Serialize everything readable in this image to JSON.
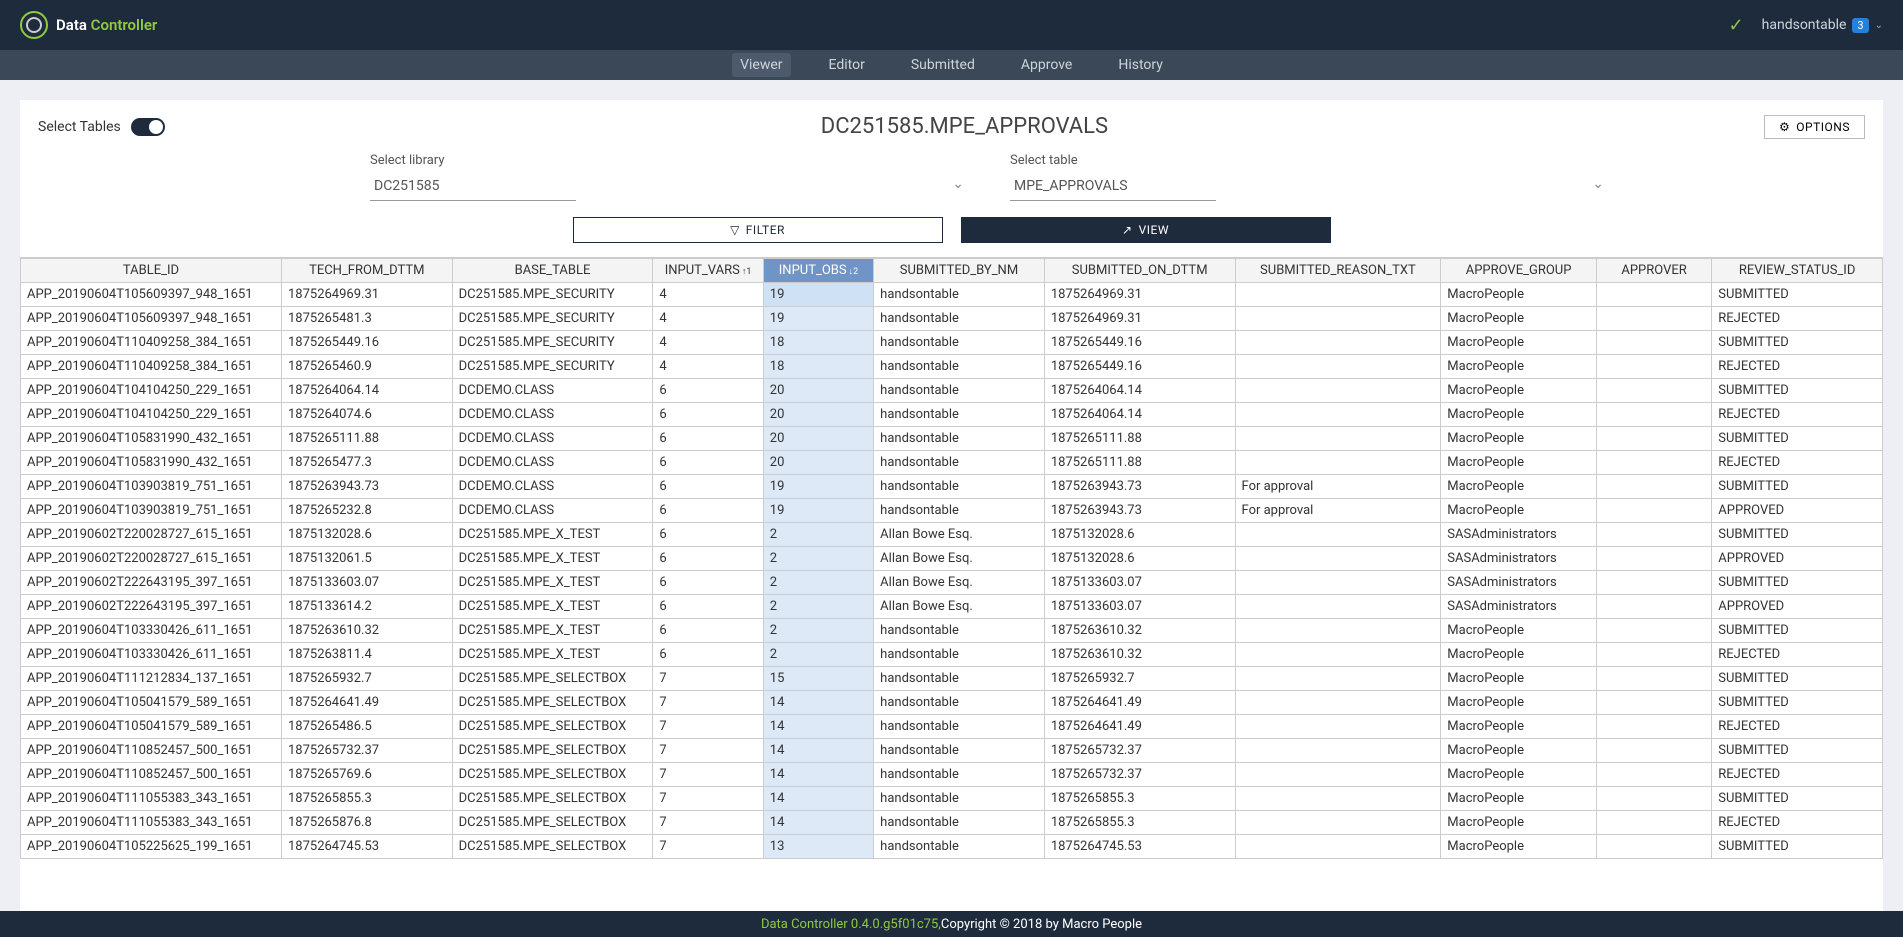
{
  "header": {
    "logo_white": "Data ",
    "logo_green": "Controller",
    "user": "handsontable",
    "badge": "3"
  },
  "nav": {
    "items": [
      "Viewer",
      "Editor",
      "Submitted",
      "Approve",
      "History"
    ],
    "active": 0
  },
  "page": {
    "select_tables_label": "Select Tables",
    "title": "DC251585.MPE_APPROVALS",
    "options_label": "OPTIONS",
    "library_label": "Select library",
    "library_value": "DC251585",
    "table_label": "Select table",
    "table_value": "MPE_APPROVALS",
    "filter_label": "FILTER",
    "view_label": "VIEW"
  },
  "columns": [
    "TABLE_ID",
    "TECH_FROM_DTTM",
    "BASE_TABLE",
    "INPUT_VARS",
    "INPUT_OBS",
    "SUBMITTED_BY_NM",
    "SUBMITTED_ON_DTTM",
    "SUBMITTED_REASON_TXT",
    "APPROVE_GROUP",
    "APPROVER",
    "REVIEW_STATUS_ID"
  ],
  "sort": {
    "col3_ind": "↑1",
    "col4_ind": "↓2"
  },
  "rows": [
    [
      "APP_20190604T105609397_948_1651",
      "1875264969.31",
      "DC251585.MPE_SECURITY",
      "4",
      "19",
      "handsontable",
      "1875264969.31",
      "",
      "MacroPeople",
      "",
      "SUBMITTED"
    ],
    [
      "APP_20190604T105609397_948_1651",
      "1875265481.3",
      "DC251585.MPE_SECURITY",
      "4",
      "19",
      "handsontable",
      "1875264969.31",
      "",
      "MacroPeople",
      "",
      "REJECTED"
    ],
    [
      "APP_20190604T110409258_384_1651",
      "1875265449.16",
      "DC251585.MPE_SECURITY",
      "4",
      "18",
      "handsontable",
      "1875265449.16",
      "",
      "MacroPeople",
      "",
      "SUBMITTED"
    ],
    [
      "APP_20190604T110409258_384_1651",
      "1875265460.9",
      "DC251585.MPE_SECURITY",
      "4",
      "18",
      "handsontable",
      "1875265449.16",
      "",
      "MacroPeople",
      "",
      "REJECTED"
    ],
    [
      "APP_20190604T104104250_229_1651",
      "1875264064.14",
      "DCDEMO.CLASS",
      "6",
      "20",
      "handsontable",
      "1875264064.14",
      "",
      "MacroPeople",
      "",
      "SUBMITTED"
    ],
    [
      "APP_20190604T104104250_229_1651",
      "1875264074.6",
      "DCDEMO.CLASS",
      "6",
      "20",
      "handsontable",
      "1875264064.14",
      "",
      "MacroPeople",
      "",
      "REJECTED"
    ],
    [
      "APP_20190604T105831990_432_1651",
      "1875265111.88",
      "DCDEMO.CLASS",
      "6",
      "20",
      "handsontable",
      "1875265111.88",
      "",
      "MacroPeople",
      "",
      "SUBMITTED"
    ],
    [
      "APP_20190604T105831990_432_1651",
      "1875265477.3",
      "DCDEMO.CLASS",
      "6",
      "20",
      "handsontable",
      "1875265111.88",
      "",
      "MacroPeople",
      "",
      "REJECTED"
    ],
    [
      "APP_20190604T103903819_751_1651",
      "1875263943.73",
      "DCDEMO.CLASS",
      "6",
      "19",
      "handsontable",
      "1875263943.73",
      "For approval",
      "MacroPeople",
      "",
      "SUBMITTED"
    ],
    [
      "APP_20190604T103903819_751_1651",
      "1875265232.8",
      "DCDEMO.CLASS",
      "6",
      "19",
      "handsontable",
      "1875263943.73",
      "For approval",
      "MacroPeople",
      "",
      "APPROVED"
    ],
    [
      "APP_20190602T220028727_615_1651",
      "1875132028.6",
      "DC251585.MPE_X_TEST",
      "6",
      "2",
      "Allan Bowe Esq.",
      "1875132028.6",
      "",
      "SASAdministrators",
      "",
      "SUBMITTED"
    ],
    [
      "APP_20190602T220028727_615_1651",
      "1875132061.5",
      "DC251585.MPE_X_TEST",
      "6",
      "2",
      "Allan Bowe Esq.",
      "1875132028.6",
      "",
      "SASAdministrators",
      "",
      "APPROVED"
    ],
    [
      "APP_20190602T222643195_397_1651",
      "1875133603.07",
      "DC251585.MPE_X_TEST",
      "6",
      "2",
      "Allan Bowe Esq.",
      "1875133603.07",
      "",
      "SASAdministrators",
      "",
      "SUBMITTED"
    ],
    [
      "APP_20190602T222643195_397_1651",
      "1875133614.2",
      "DC251585.MPE_X_TEST",
      "6",
      "2",
      "Allan Bowe Esq.",
      "1875133603.07",
      "",
      "SASAdministrators",
      "",
      "APPROVED"
    ],
    [
      "APP_20190604T103330426_611_1651",
      "1875263610.32",
      "DC251585.MPE_X_TEST",
      "6",
      "2",
      "handsontable",
      "1875263610.32",
      "",
      "MacroPeople",
      "",
      "SUBMITTED"
    ],
    [
      "APP_20190604T103330426_611_1651",
      "1875263811.4",
      "DC251585.MPE_X_TEST",
      "6",
      "2",
      "handsontable",
      "1875263610.32",
      "",
      "MacroPeople",
      "",
      "REJECTED"
    ],
    [
      "APP_20190604T111212834_137_1651",
      "1875265932.7",
      "DC251585.MPE_SELECTBOX",
      "7",
      "15",
      "handsontable",
      "1875265932.7",
      "",
      "MacroPeople",
      "",
      "SUBMITTED"
    ],
    [
      "APP_20190604T105041579_589_1651",
      "1875264641.49",
      "DC251585.MPE_SELECTBOX",
      "7",
      "14",
      "handsontable",
      "1875264641.49",
      "",
      "MacroPeople",
      "",
      "SUBMITTED"
    ],
    [
      "APP_20190604T105041579_589_1651",
      "1875265486.5",
      "DC251585.MPE_SELECTBOX",
      "7",
      "14",
      "handsontable",
      "1875264641.49",
      "",
      "MacroPeople",
      "",
      "REJECTED"
    ],
    [
      "APP_20190604T110852457_500_1651",
      "1875265732.37",
      "DC251585.MPE_SELECTBOX",
      "7",
      "14",
      "handsontable",
      "1875265732.37",
      "",
      "MacroPeople",
      "",
      "SUBMITTED"
    ],
    [
      "APP_20190604T110852457_500_1651",
      "1875265769.6",
      "DC251585.MPE_SELECTBOX",
      "7",
      "14",
      "handsontable",
      "1875265732.37",
      "",
      "MacroPeople",
      "",
      "REJECTED"
    ],
    [
      "APP_20190604T111055383_343_1651",
      "1875265855.3",
      "DC251585.MPE_SELECTBOX",
      "7",
      "14",
      "handsontable",
      "1875265855.3",
      "",
      "MacroPeople",
      "",
      "SUBMITTED"
    ],
    [
      "APP_20190604T111055383_343_1651",
      "1875265876.8",
      "DC251585.MPE_SELECTBOX",
      "7",
      "14",
      "handsontable",
      "1875265855.3",
      "",
      "MacroPeople",
      "",
      "REJECTED"
    ],
    [
      "APP_20190604T105225625_199_1651",
      "1875264745.53",
      "DC251585.MPE_SELECTBOX",
      "7",
      "13",
      "handsontable",
      "1875264745.53",
      "",
      "MacroPeople",
      "",
      "SUBMITTED"
    ]
  ],
  "footer": {
    "green": "Data Controller 0.4.0.g5f01c75,",
    "white": " Copyright © 2018 by Macro People"
  }
}
